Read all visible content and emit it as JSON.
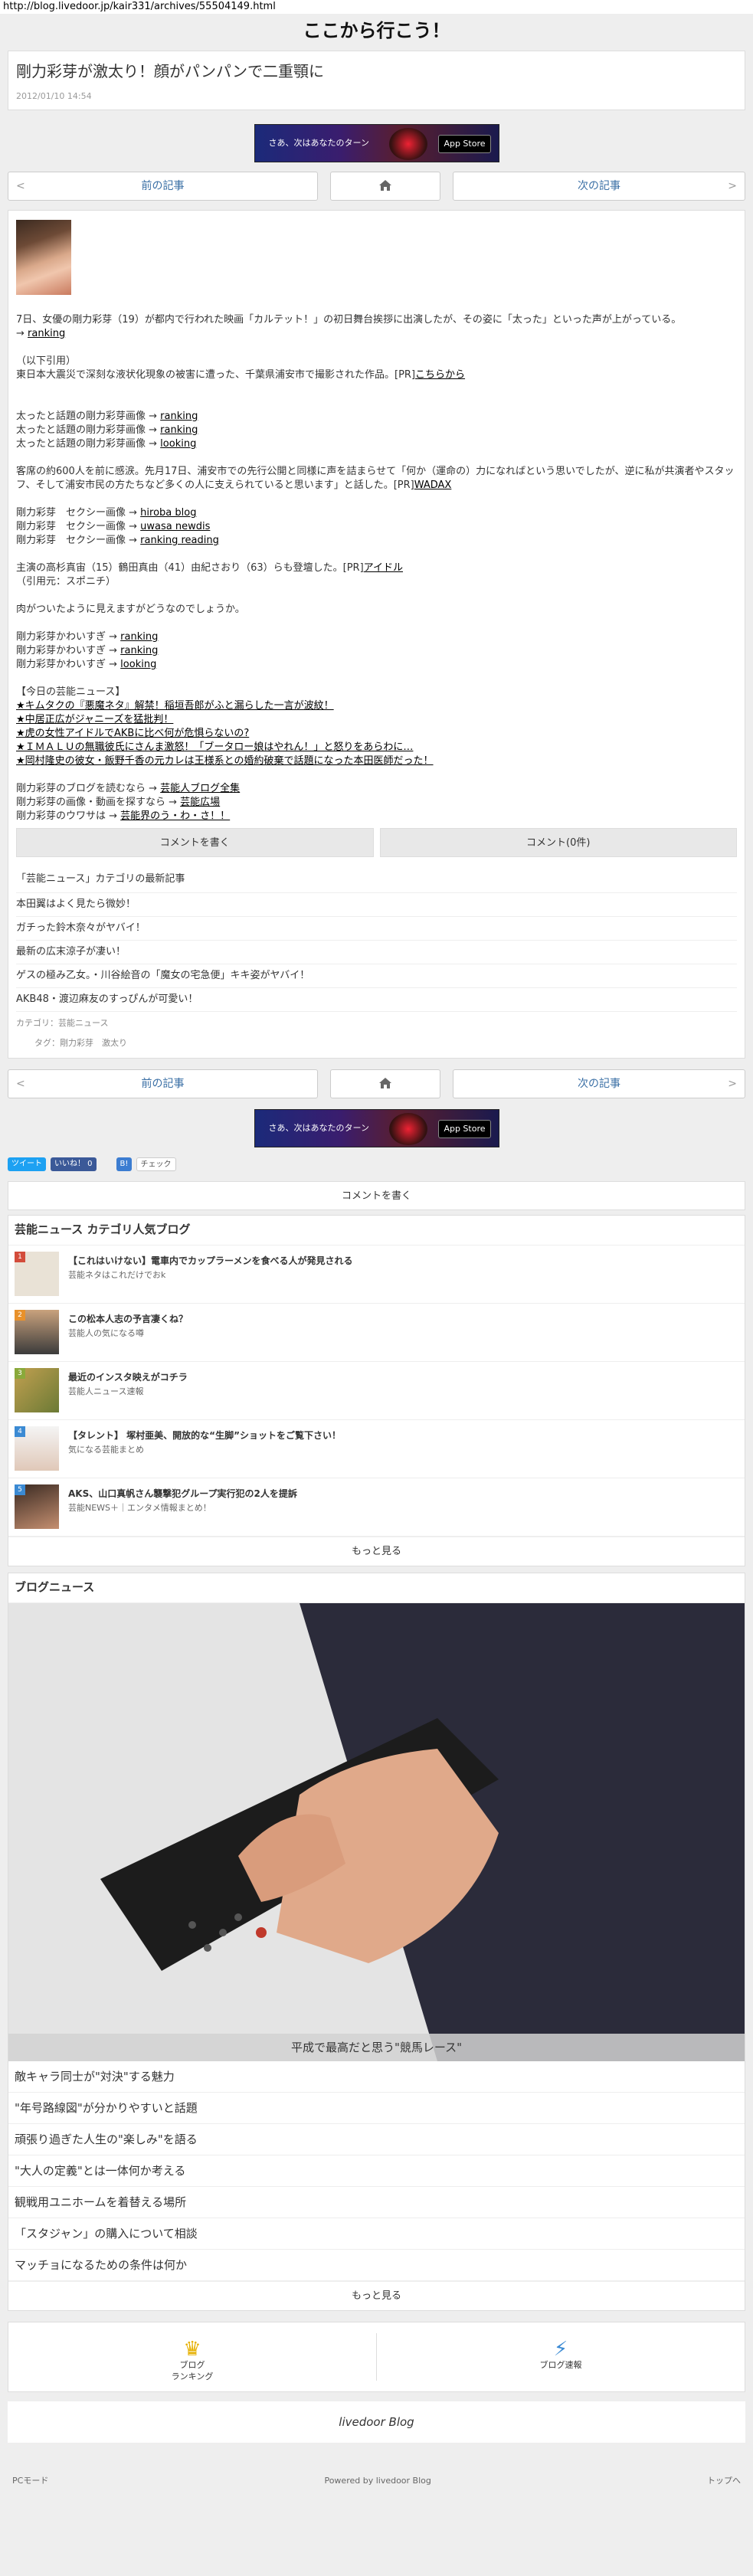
{
  "url": "http://blog.livedoor.jp/kair331/archives/55504149.html",
  "blog_title": "ここから行こう！",
  "article": {
    "title": "剛力彩芽が激太り！顔がパンパンで二重顎に",
    "date": "2012/01/10 14:54"
  },
  "banner": {
    "text": "さあ、次はあなたのターン",
    "store": "App Store"
  },
  "pager": {
    "prev": "前の記事",
    "next": "次の記事"
  },
  "body": {
    "p1": "7日、女優の剛力彩芽（19）が都内で行われた映画「カルテット！」の初日舞台挨拶に出演したが、その姿に「太った」といった声が上がっている。",
    "p1_arrow": "→",
    "p1_link": "ranking",
    "p2a": "（以下引用）",
    "p2b": "東日本大震災で深刻な液状化現象の被害に遭った、千葉県浦安市で撮影された作品。[PR]",
    "p2_link": "こちらから",
    "list1": [
      {
        "text": "太ったと話題の剛力彩芽画像 → ",
        "link": "ranking"
      },
      {
        "text": "太ったと話題の剛力彩芽画像 → ",
        "link": "ranking"
      },
      {
        "text": "太ったと話題の剛力彩芽画像 → ",
        "link": "looking"
      }
    ],
    "p3": "客席の約600人を前に感涙。先月17日、浦安市での先行公開と同様に声を詰まらせて「何か（運命の）力になればという思いでしたが、逆に私が共演者やスタッフ、そして浦安市民の方たちなど多くの人に支えられていると思います」と話した。[PR]",
    "p3_link": "WADAX",
    "list2": [
      {
        "text": "剛力彩芽　セクシー画像 → ",
        "link": "hiroba blog"
      },
      {
        "text": "剛力彩芽　セクシー画像 → ",
        "link": "uwasa newdis"
      },
      {
        "text": "剛力彩芽　セクシー画像 → ",
        "link": "ranking reading"
      }
    ],
    "p4": "主演の高杉真宙（15）鶴田真由（41）由紀さおり（63）らも登壇した。[PR]",
    "p4_link": "アイドル",
    "p4_src": "（引用元：スポニチ）",
    "p5": "肉がついたように見えますがどうなのでしょうか。",
    "list3": [
      {
        "text": "剛力彩芽かわいすぎ → ",
        "link": "ranking"
      },
      {
        "text": "剛力彩芽かわいすぎ → ",
        "link": "ranking"
      },
      {
        "text": "剛力彩芽かわいすぎ → ",
        "link": "looking"
      }
    ],
    "news_head": "【今日の芸能ニュース】",
    "news": [
      "★キムタクの『悪魔ネタ』解禁！稲垣吾郎がふと漏らした一言が波紋！",
      "★中居正広がジャニーズを猛批判！",
      "★虎の女性アイドルでAKBに比べ何が危惧らないの?",
      "★ＩＭＡＬＵの無職彼氏にさんま激怒！「ブータロー娘はやれん！」と怒りをあらわに…",
      "★岡村隆史の彼女・飯野千香の元カレは王様系との婚約破棄で話題になった本田医師だった！"
    ],
    "list4": [
      {
        "text": "剛力彩芽のブログを読むなら → ",
        "link": "芸能人ブログ全集"
      },
      {
        "text": "剛力彩芽の画像・動画を探すなら → ",
        "link": "芸能広場"
      },
      {
        "text": "剛力彩芽のウワサは → ",
        "link": "芸能界のう・わ・さ！！"
      }
    ]
  },
  "comment": {
    "write": "コメントを書く",
    "count": "コメント(0件)"
  },
  "recent": {
    "heading": "「芸能ニュース」カテゴリの最新記事",
    "items": [
      "本田翼はよく見たら微妙！",
      "ガチった鈴木奈々がヤバイ！",
      "最新の広末涼子が凄い！",
      "ゲスの極み乙女。・川谷絵音の「魔女の宅急便」キキ姿がヤバイ！",
      "AKB48・渡辺麻友のすっぴんが可愛い！"
    ]
  },
  "meta": {
    "category_label": "カテゴリ：",
    "category": "芸能ニュース",
    "tag_label": "タグ：",
    "tags": "剛力彩芽　激太り"
  },
  "social": {
    "tweet": "ツイート",
    "like": "いいね！ 0",
    "hatena": "B!",
    "check": "チェック"
  },
  "comment_write2": "コメントを書く",
  "popular": {
    "heading": "芸能ニュース カテゴリ人気ブログ",
    "items": [
      {
        "rank": "1",
        "title": "【これはいけない】電車内でカップラーメンを食べる人が発見される",
        "sub": "芸能ネタはこれだけでおk",
        "color": "#d34c3b"
      },
      {
        "rank": "2",
        "title": "この松本人志の予言凄くね？",
        "sub": "芸能人の気になる噂",
        "color": "#e8912b"
      },
      {
        "rank": "3",
        "title": "最近のインスタ映えがコチラ",
        "sub": "芸能人ニュース速報",
        "color": "#8aa93b"
      },
      {
        "rank": "4",
        "title": "【タレント】 塚村亜美、開放的な“生脚”ショットをご覧下さい！",
        "sub": "気になる芸能まとめ",
        "color": "#3b8ad3"
      },
      {
        "rank": "5",
        "title": "AKS、山口真帆さん襲撃犯グループ実行犯の2人を提訴",
        "sub": "芸能NEWS＋｜エンタメ情報まとめ！",
        "color": "#3b8ad3"
      }
    ],
    "more": "もっと見る"
  },
  "blognews": {
    "heading": "ブログニュース",
    "feature": "平成で最高だと思う\"競馬レース\"",
    "items": [
      "敵キャラ同士が\"対決\"する魅力",
      "\"年号路線図\"が分かりやすいと話題",
      "頑張り過ぎた人生の\"楽しみ\"を語る",
      "\"大人の定義\"とは一体何か考える",
      "観戦用ユニホームを着替える場所",
      "「スタジャン」の購入について相談",
      "マッチョになるための条件は何か"
    ],
    "more": "もっと見る"
  },
  "footnav": {
    "ranking": "ブログ\nランキング",
    "ranking_a": "ブログ",
    "ranking_b": "ランキング",
    "news": "ブログ速報"
  },
  "livedoor": "livedoor Blog",
  "bottom": {
    "pc": "PCモード",
    "powered": "Powered by livedoor Blog",
    "top": "トップへ"
  }
}
